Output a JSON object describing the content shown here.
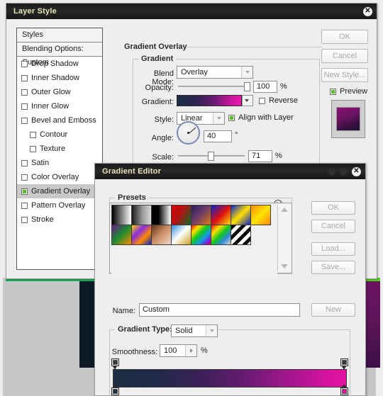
{
  "layer_style": {
    "title": "Layer Style",
    "close_icon": "close-icon",
    "styles_list": {
      "header": "Styles",
      "blending_options": "Blending Options: Custom",
      "items": [
        {
          "label": "Drop Shadow",
          "checked": false,
          "indent": false,
          "selected": false
        },
        {
          "label": "Inner Shadow",
          "checked": false,
          "indent": false,
          "selected": false
        },
        {
          "label": "Outer Glow",
          "checked": false,
          "indent": false,
          "selected": false
        },
        {
          "label": "Inner Glow",
          "checked": false,
          "indent": false,
          "selected": false
        },
        {
          "label": "Bevel and Emboss",
          "checked": false,
          "indent": false,
          "selected": false
        },
        {
          "label": "Contour",
          "checked": false,
          "indent": true,
          "selected": false
        },
        {
          "label": "Texture",
          "checked": false,
          "indent": true,
          "selected": false
        },
        {
          "label": "Satin",
          "checked": false,
          "indent": false,
          "selected": false
        },
        {
          "label": "Color Overlay",
          "checked": false,
          "indent": false,
          "selected": false
        },
        {
          "label": "Gradient Overlay",
          "checked": true,
          "indent": false,
          "selected": true
        },
        {
          "label": "Pattern Overlay",
          "checked": false,
          "indent": false,
          "selected": false
        },
        {
          "label": "Stroke",
          "checked": false,
          "indent": false,
          "selected": false
        }
      ]
    },
    "panel": {
      "section_title": "Gradient Overlay",
      "group_title": "Gradient",
      "blend_mode_label": "Blend Mode:",
      "blend_mode_value": "Overlay",
      "opacity_label": "Opacity:",
      "opacity_value": "100",
      "opacity_unit": "%",
      "gradient_label": "Gradient:",
      "reverse_label": "Reverse",
      "reverse_checked": false,
      "style_label": "Style:",
      "style_value": "Linear",
      "align_label": "Align with Layer",
      "align_checked": true,
      "angle_label": "Angle:",
      "angle_value": "40",
      "angle_unit": "°",
      "scale_label": "Scale:",
      "scale_value": "71",
      "scale_unit": "%"
    },
    "buttons": {
      "ok": "OK",
      "cancel": "Cancel",
      "new_style": "New Style...",
      "preview_label": "Preview",
      "preview_checked": true
    }
  },
  "gradient_editor": {
    "title": "Gradient Editor",
    "close_icon": "close-icon",
    "presets_label": "Presets",
    "presets": [
      {
        "name": "foreground-to-background",
        "css": "linear-gradient(90deg,#000 0%,#fff 100%)"
      },
      {
        "name": "foreground-to-transparent",
        "css": "linear-gradient(90deg,#1a1a1a 0%,#9a9a9a 55%,#d8d8d8 100%)"
      },
      {
        "name": "black-white",
        "css": "linear-gradient(90deg,#000 0%,#000 35%,#fff 100%)"
      },
      {
        "name": "red-green",
        "css": "linear-gradient(120deg,#d40000 0%,#b41212 45%,#0a6b2c 100%)"
      },
      {
        "name": "violet-orange",
        "css": "linear-gradient(135deg,#2b1a5c 0%,#6a3a6a 45%,#e07a10 100%)"
      },
      {
        "name": "blue-red-yellow",
        "css": "linear-gradient(135deg,#0a22c8 0%,#e01010 52%,#ffe000 100%)"
      },
      {
        "name": "blue-yellow-blue",
        "css": "linear-gradient(135deg,#0a22c8 0%,#ffe000 50%,#0a22c8 100%)"
      },
      {
        "name": "orange-yellow-orange",
        "css": "linear-gradient(135deg,#ff8a00 0%,#ffe400 50%,#ff8a00 100%)"
      },
      {
        "name": "violet-green-orange",
        "css": "linear-gradient(135deg,#6b1a8c 0%,#1a8c2e 48%,#ff8a00 100%)"
      },
      {
        "name": "yellow-violet-orange-blue",
        "css": "linear-gradient(135deg,#ffd400 0%,#8a2be2 35%,#ff8a00 65%,#0a22c8 100%)"
      },
      {
        "name": "copper",
        "css": "linear-gradient(135deg,#5a3116 0%,#c98a60 45%,#f0d8c8 100%)"
      },
      {
        "name": "chrome",
        "css": "linear-gradient(135deg,#2f8ad8 0%,#ffffff 48%,#c8a020 100%)"
      },
      {
        "name": "spectrum",
        "css": "linear-gradient(135deg,#e01010 0%,#ffe000 22%,#10c820 44%,#10a0e0 66%,#8a10e0 88%,#e01010 100%)"
      },
      {
        "name": "transparent-rainbow",
        "css": "linear-gradient(135deg,#e01010 0%,#ffe000 25%,#10c820 50%,#2f8ad8 72%,#d8d8d8 100%)"
      },
      {
        "name": "transparent-stripes",
        "css": "repeating-linear-gradient(135deg,#0a0a0a 0 5px,#ffffff 5px 10px)"
      }
    ],
    "buttons": {
      "ok": "OK",
      "cancel": "Cancel",
      "load": "Load...",
      "save": "Save...",
      "new": "New"
    },
    "name_label": "Name:",
    "name_value": "Custom",
    "gradient_type_label": "Gradient Type:",
    "gradient_type_value": "Solid",
    "smoothness_label": "Smoothness:",
    "smoothness_value": "100",
    "smoothness_unit": "%",
    "gradient_stops": {
      "opacity_stops": [
        {
          "position": 0,
          "opacity": 100
        },
        {
          "position": 100,
          "opacity": 100
        }
      ],
      "color_stops": [
        {
          "position": 0,
          "color": "#1b2e43"
        },
        {
          "position": 100,
          "color": "#e511a1"
        }
      ]
    }
  },
  "colors": {
    "accent_green": "#54c21a",
    "title_text": "#e8e3b8",
    "gradient_start": "#1b2e43",
    "gradient_end": "#e511a1",
    "doc_green_bar": "#15b45a",
    "doc_purple": "#5d1459"
  }
}
